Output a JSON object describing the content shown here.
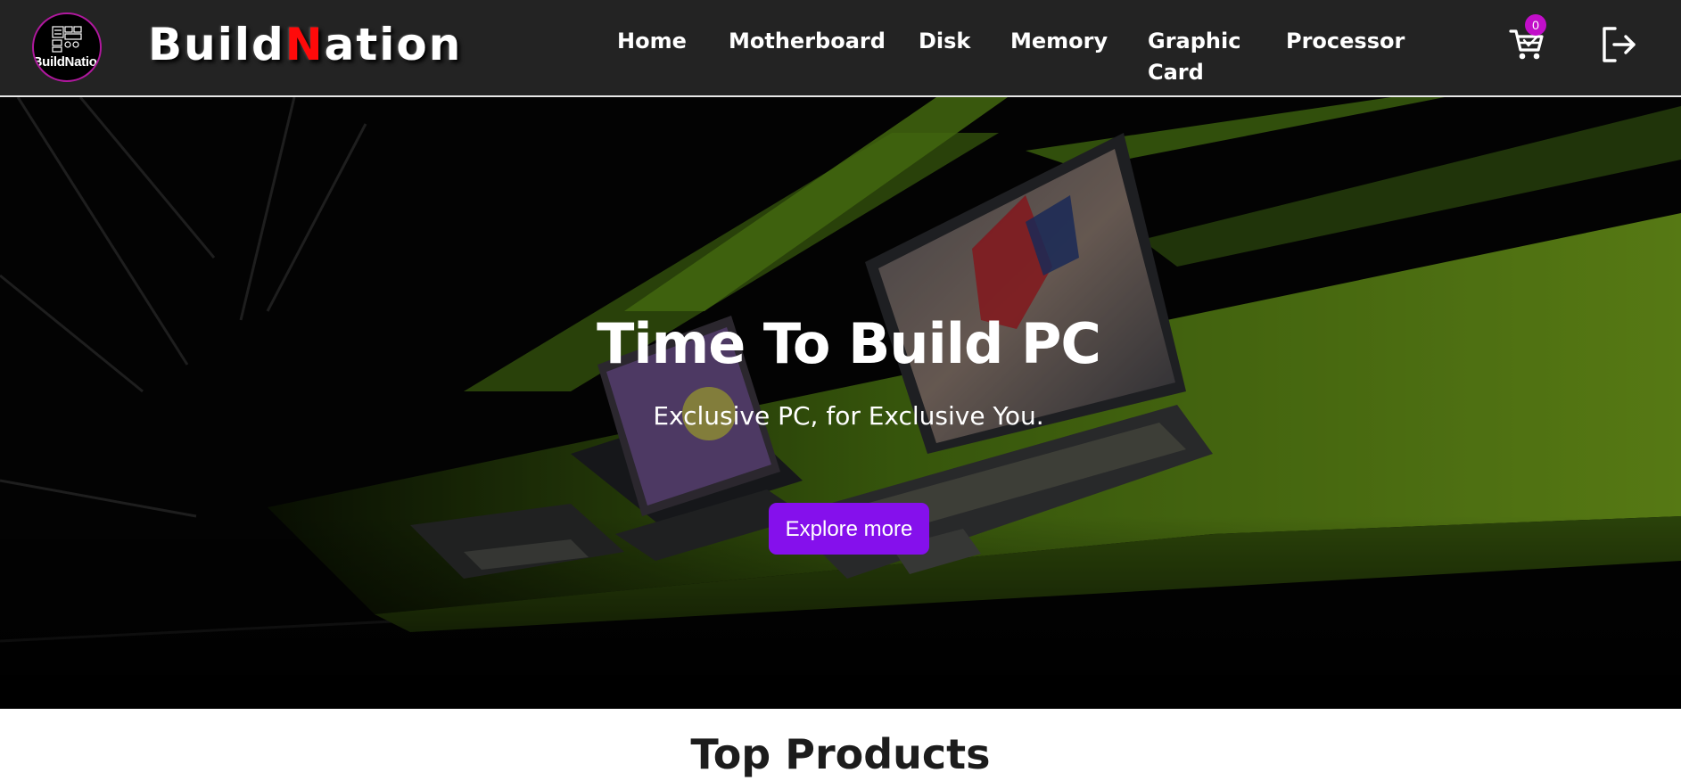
{
  "brand": {
    "badge_text": "BuildNation",
    "name_prefix": "Build",
    "name_accent": "N",
    "name_suffix": "ation",
    "accent_color": "#ff0a0a",
    "badge_ring_color": "#b0189e"
  },
  "nav": {
    "items": [
      {
        "label": "Home"
      },
      {
        "label": "Motherboard"
      },
      {
        "label": "Disk"
      },
      {
        "label": "Memory"
      },
      {
        "label": "Graphic Card"
      },
      {
        "label": "Processor"
      }
    ],
    "cart_icon": "shopping-cart-icon",
    "cart_count": "0",
    "logout_icon": "logout-icon",
    "background_color": "#232323"
  },
  "hero": {
    "title": "Time To Build PC",
    "subtitle": "Exclusive PC, for Exclusive You.",
    "button_label": "Explore more",
    "button_color": "#8510ec",
    "scene_accent_color": "#7cb518"
  },
  "next_section": {
    "heading": "Top Products"
  }
}
